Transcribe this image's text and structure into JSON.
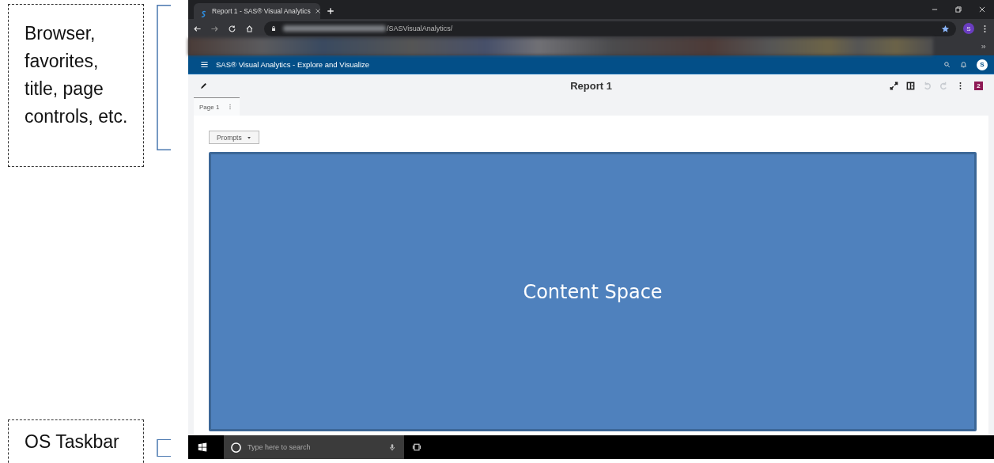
{
  "annotations": [
    {
      "text": "Browser, favorites, title, page controls, etc.",
      "kind": "top"
    },
    {
      "text": "OS Taskbar",
      "kind": "bottom"
    }
  ],
  "browser": {
    "tabs": [
      {
        "title": "Report 1 - SAS® Visual Analytics",
        "selected": true
      }
    ],
    "address": {
      "path": "/SASVisualAnalytics/"
    },
    "profile_initial": "S"
  },
  "app": {
    "title": "SAS® Visual Analytics - Explore and Visualize",
    "user_initial": "S",
    "report_title": "Report 1",
    "actions": [
      {
        "kind": "expand",
        "disabled": false
      },
      {
        "kind": "layout",
        "disabled": false
      },
      {
        "kind": "undo",
        "disabled": true
      },
      {
        "kind": "redo",
        "disabled": true
      },
      {
        "kind": "more",
        "disabled": false
      }
    ],
    "badge": "2",
    "pages": [
      {
        "label": "Page 1",
        "selected": true
      }
    ],
    "prompts_button": "Prompts",
    "content_area": {
      "label": "Content Space"
    }
  },
  "taskbar": {
    "search": {
      "placeholder": "Type here to search"
    }
  }
}
